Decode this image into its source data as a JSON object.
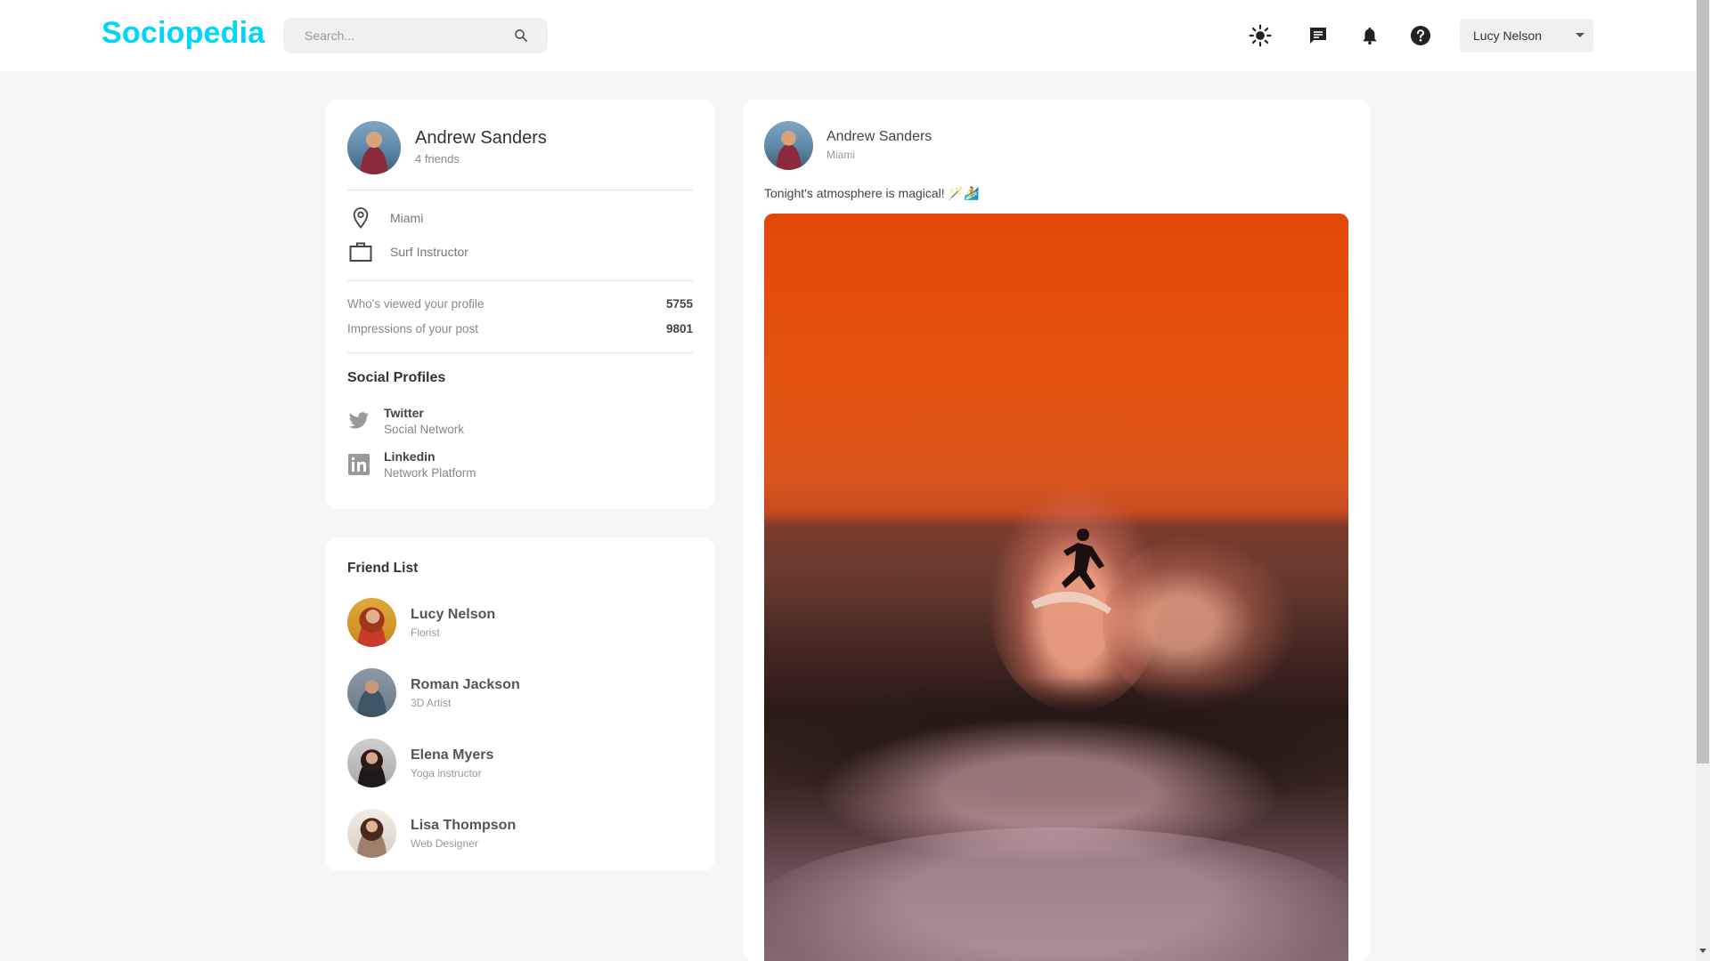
{
  "app": {
    "logo": "Sociopedia"
  },
  "navbar": {
    "search_placeholder": "Search...",
    "user_select": "Lucy Nelson",
    "icons": [
      "sun-icon",
      "message-icon",
      "bell-icon",
      "help-icon"
    ]
  },
  "user_widget": {
    "name": "Andrew Sanders",
    "friends": "4 friends",
    "location": "Miami",
    "occupation": "Surf Instructor",
    "stats": [
      {
        "label": "Who's viewed your profile",
        "value": "5755"
      },
      {
        "label": "Impressions of your post",
        "value": "9801"
      }
    ],
    "social_title": "Social Profiles",
    "socials": [
      {
        "name": "Twitter",
        "desc": "Social Network"
      },
      {
        "name": "Linkedin",
        "desc": "Network Platform"
      }
    ]
  },
  "friends_widget": {
    "title": "Friend List",
    "friends": [
      {
        "name": "Lucy Nelson",
        "desc": "Florist"
      },
      {
        "name": "Roman Jackson",
        "desc": "3D Artist"
      },
      {
        "name": "Elena Myers",
        "desc": "Yoga instructor"
      },
      {
        "name": "Lisa Thompson",
        "desc": "Web Designer"
      }
    ]
  },
  "post": {
    "name": "Andrew Sanders",
    "location": "Miami",
    "text": "Tonight's atmosphere is magical! 🪄🏄"
  },
  "colors": {
    "brand": "#00d5fa",
    "background": "#f6f6f6"
  }
}
